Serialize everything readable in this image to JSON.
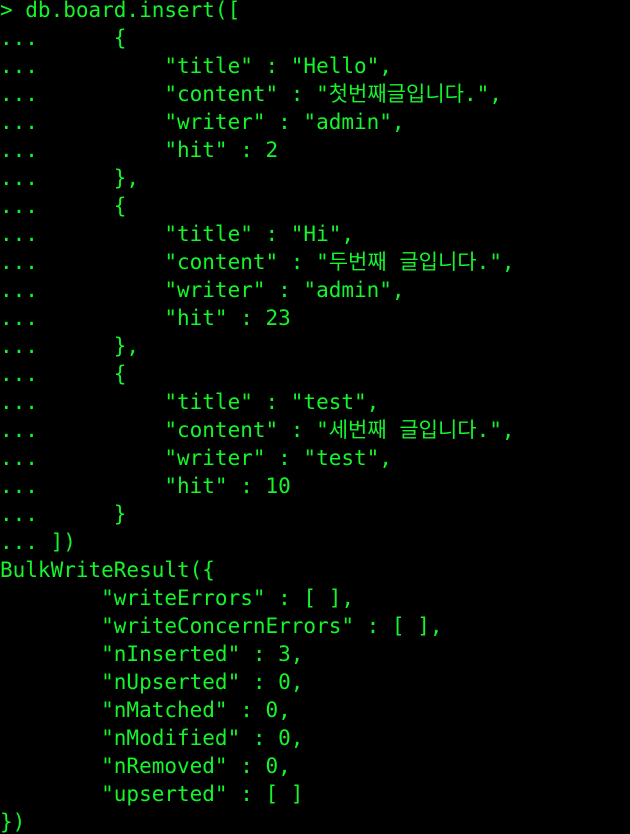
{
  "terminal": {
    "text_color": "#14f52b",
    "background_color": "#000000",
    "lines": [
      "> db.board.insert([",
      "...      {",
      "...          \"title\" : \"Hello\",",
      "...          \"content\" : \"첫번째글입니다.\",",
      "...          \"writer\" : \"admin\",",
      "...          \"hit\" : 2",
      "...      },",
      "...      {",
      "...          \"title\" : \"Hi\",",
      "...          \"content\" : \"두번째 글입니다.\",",
      "...          \"writer\" : \"admin\",",
      "...          \"hit\" : 23",
      "...      },",
      "...      {",
      "...          \"title\" : \"test\",",
      "...          \"content\" : \"세번째 글입니다.\",",
      "...          \"writer\" : \"test\",",
      "...          \"hit\" : 10",
      "...      }",
      "... ])",
      "BulkWriteResult({",
      "        \"writeErrors\" : [ ],",
      "        \"writeConcernErrors\" : [ ],",
      "        \"nInserted\" : 3,",
      "        \"nUpserted\" : 0,",
      "        \"nMatched\" : 0,",
      "        \"nModified\" : 0,",
      "        \"nRemoved\" : 0,",
      "        \"upserted\" : [ ]",
      "})"
    ]
  }
}
